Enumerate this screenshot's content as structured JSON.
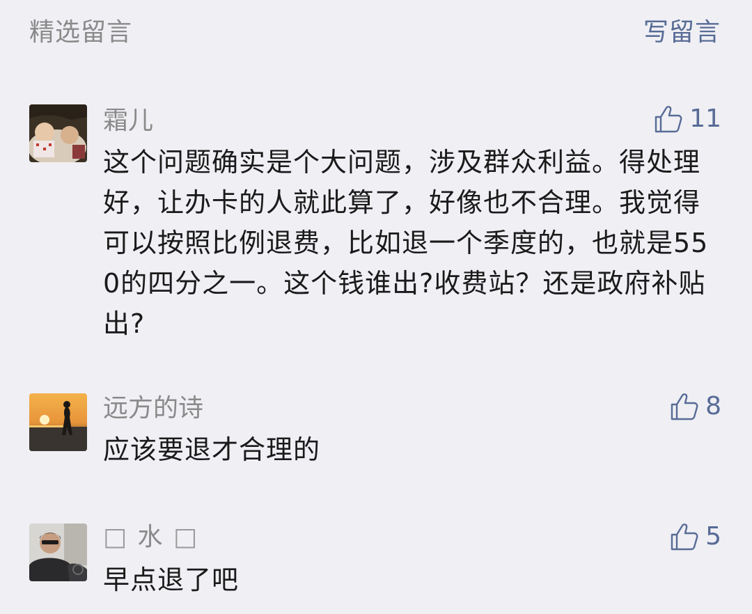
{
  "header": {
    "title": "精选留言",
    "write_label": "写留言"
  },
  "colors": {
    "background": "#efeff4",
    "link": "#576b95",
    "secondary_text": "#8a8a8a",
    "primary_text": "#1a1a1a"
  },
  "comments": [
    {
      "nickname": "霜儿",
      "content": "这个问题确实是个大问题，涉及群众利益。得处理好，让办卡的人就此算了，好像也不合理。我觉得可以按照比例退费，比如退一个季度的，也就是550的四分之一。这个钱谁出?收费站？还是政府补贴出?",
      "likes": "11",
      "like_icon": "thumbs-up-icon"
    },
    {
      "nickname": "远方的诗",
      "content": "应该要退才合理的",
      "likes": "8",
      "like_icon": "thumbs-up-icon"
    },
    {
      "nickname_prefix": "□",
      "nickname": "水",
      "nickname_suffix": "□",
      "content": "早点退了吧",
      "likes": "5",
      "like_icon": "thumbs-up-icon"
    }
  ]
}
